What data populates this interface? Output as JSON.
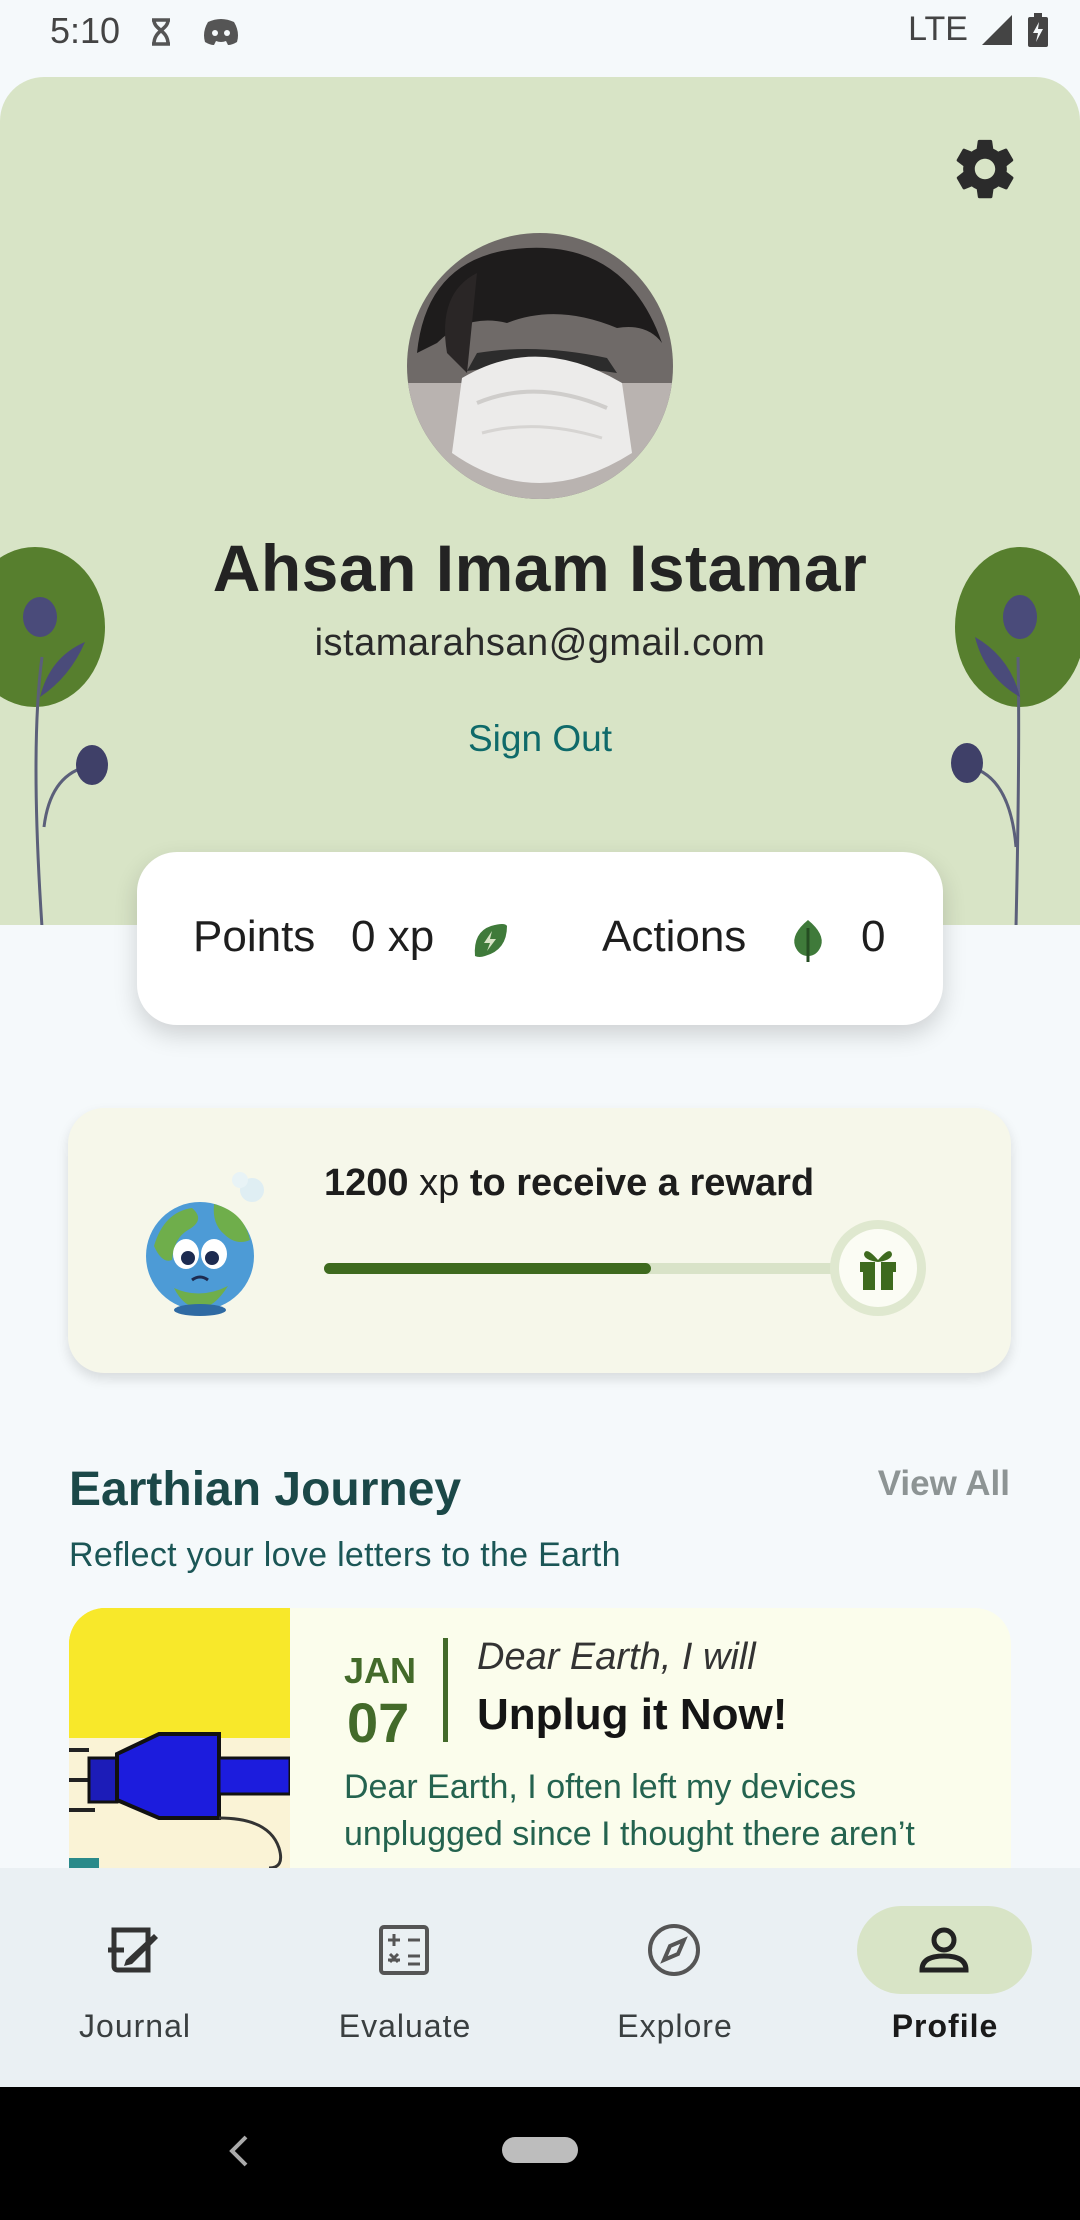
{
  "status_bar": {
    "time": "5:10",
    "network": "LTE"
  },
  "profile": {
    "name": "Ahsan Imam Istamar",
    "email": "istamarahsan@gmail.com",
    "sign_out_label": "Sign Out"
  },
  "stats": {
    "points_label": "Points",
    "points_value": "0 xp",
    "actions_label": "Actions",
    "actions_value": "0"
  },
  "reward": {
    "amount": "1200",
    "unit": "xp",
    "text": "to receive a reward",
    "progress": 0.6
  },
  "journey": {
    "title": "Earthian Journey",
    "view_all_label": "View All",
    "subtitle": "Reflect your love letters to the Earth",
    "entry": {
      "month": "JAN",
      "day": "07",
      "prefix": "Dear Earth, I will",
      "title": "Unplug it Now!",
      "body": "Dear Earth, I often left my devices unplugged since I thought there aren’t"
    }
  },
  "bottom_nav": [
    {
      "label": "Journal",
      "icon": "journal-icon",
      "active": false
    },
    {
      "label": "Evaluate",
      "icon": "calculator-icon",
      "active": false
    },
    {
      "label": "Explore",
      "icon": "compass-icon",
      "active": false
    },
    {
      "label": "Profile",
      "icon": "person-icon",
      "active": true
    }
  ],
  "colors": {
    "header_bg": "#d8e4c6",
    "accent_green": "#3e6a1e",
    "teal": "#0f6a6a",
    "active_pill": "#d8e4c6"
  }
}
